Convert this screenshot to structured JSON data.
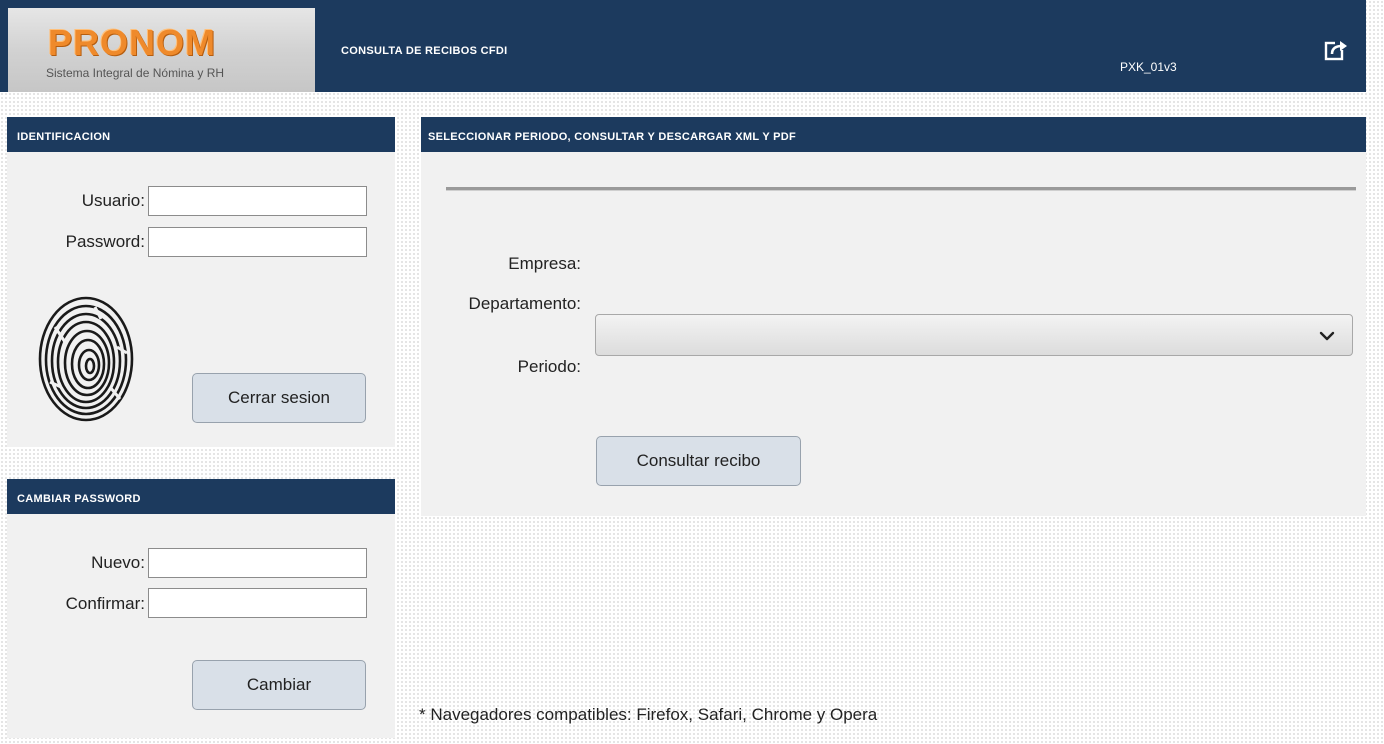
{
  "header": {
    "logo_text": "PRONOM",
    "logo_subtitle": "Sistema Integral de Nómina y RH",
    "app_title": "CONSULTA DE RECIBOS CFDI",
    "version": "PXK_01v3",
    "exit_icon": "logout-share-icon"
  },
  "identificacion": {
    "title": "IDENTIFICACION",
    "usuario_label": "Usuario:",
    "usuario_value": "",
    "password_label": "Password:",
    "password_value": "",
    "fingerprint_icon": "fingerprint-icon",
    "logout_label": "Cerrar sesion"
  },
  "cambiar_password": {
    "title": "CAMBIAR PASSWORD",
    "nuevo_label": "Nuevo:",
    "nuevo_value": "",
    "confirmar_label": "Confirmar:",
    "confirmar_value": "",
    "submit_label": "Cambiar"
  },
  "consulta": {
    "title": "SELECCIONAR PERIODO, CONSULTAR Y DESCARGAR XML Y PDF",
    "empresa_label": "Empresa:",
    "empresa_value": "",
    "departamento_label": "Departamento:",
    "departamento_value": "",
    "periodo_label": "Periodo:",
    "periodo_selected": "",
    "submit_label": "Consultar recibo"
  },
  "footer": {
    "note": "* Navegadores compatibles: Firefox, Safari, Chrome y Opera"
  },
  "colors": {
    "header_bg": "#1c3a5e",
    "panel_bg": "#f1f1f1",
    "logo_orange": "#ef8a2b",
    "button_bg": "#d9e0e8"
  }
}
